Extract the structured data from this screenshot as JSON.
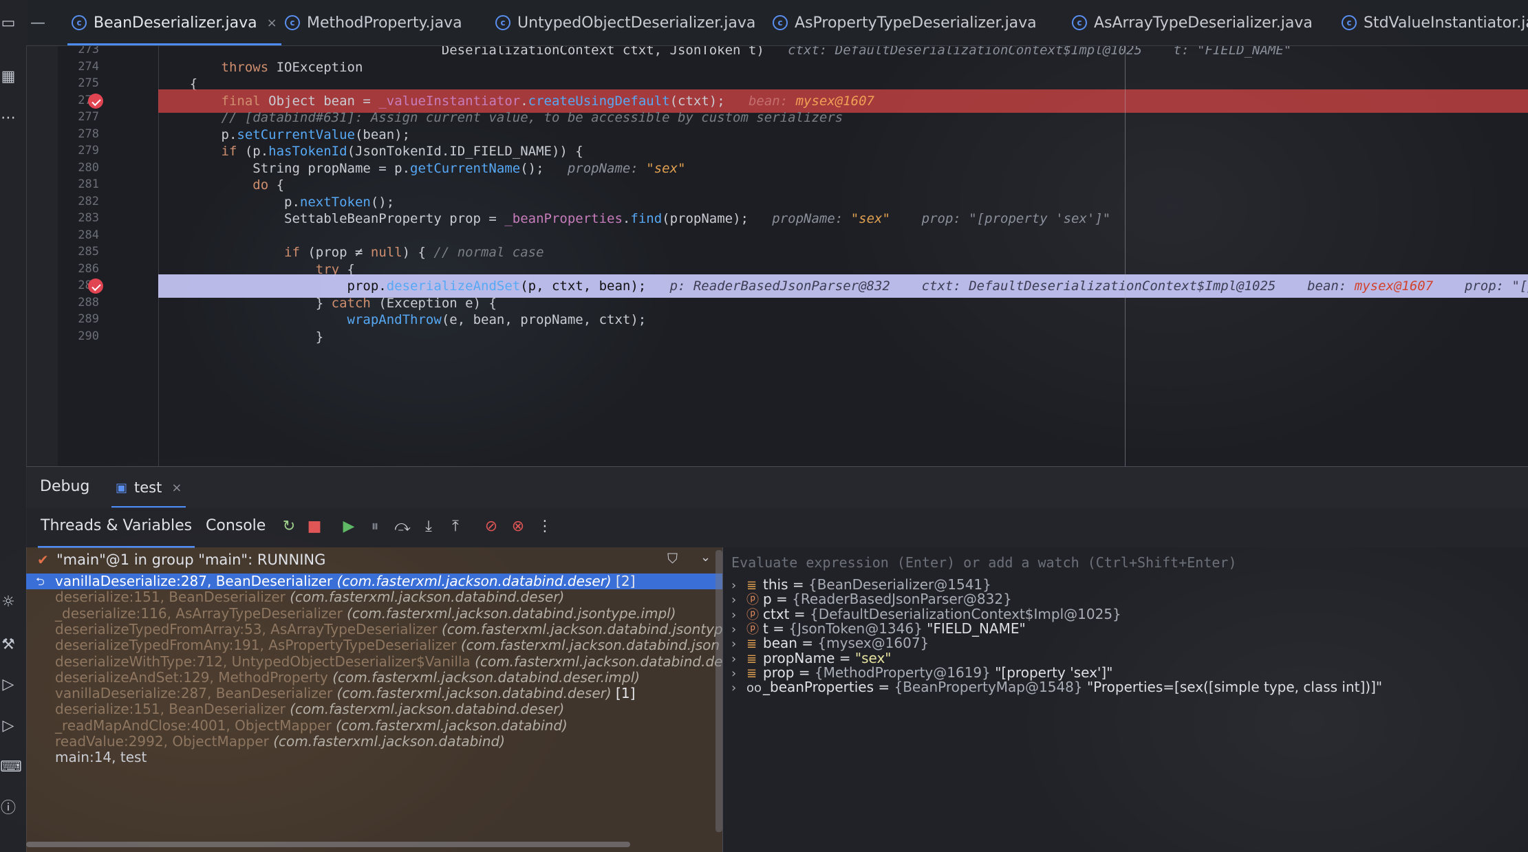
{
  "tabs": [
    {
      "label": "BeanDeserializer.java",
      "active": true,
      "closable": true
    },
    {
      "label": "MethodProperty.java"
    },
    {
      "label": "UntypedObjectDeserializer.java"
    },
    {
      "label": "AsPropertyTypeDeserializer.java"
    },
    {
      "label": "AsArrayTypeDeserializer.java"
    },
    {
      "label": "StdValueInstantiator.jav"
    }
  ],
  "editor": {
    "lines": [
      {
        "num": "273",
        "code": "                                    DeserializationContext ctxt, JsonToken t)",
        "hint": "ctxt: DefaultDeserializationContext$Impl@1025    t: \"FIELD_NAME\""
      },
      {
        "num": "274",
        "code": "        throws IOException"
      },
      {
        "num": "275",
        "code": "    {"
      },
      {
        "num": "276",
        "code": "        final Object bean = _valueInstantiator.createUsingDefault(ctxt);",
        "hint": "bean:",
        "hint_value": "mysex@1607",
        "state": "breakpoint"
      },
      {
        "num": "277",
        "code": "        // [databind#631]: Assign current value, to be accessible by custom serializers"
      },
      {
        "num": "278",
        "code": "        p.setCurrentValue(bean);"
      },
      {
        "num": "279",
        "code": "        if (p.hasTokenId(JsonTokenId.ID_FIELD_NAME)) {"
      },
      {
        "num": "280",
        "code": "            String propName = p.getCurrentName();",
        "hint": "propName:",
        "hint_value": "\"sex\""
      },
      {
        "num": "281",
        "code": "            do {"
      },
      {
        "num": "282",
        "code": "                p.nextToken();"
      },
      {
        "num": "283",
        "code": "                SettableBeanProperty prop = _beanProperties.find(propName);",
        "hint": "propName:",
        "hint_value": "\"sex\"",
        "hint2": "prop: \"[property 'sex']\""
      },
      {
        "num": "284",
        "code": ""
      },
      {
        "num": "285",
        "code": "                if (prop ≠ null) { // normal case"
      },
      {
        "num": "286",
        "code": "                    try {"
      },
      {
        "num": "287",
        "code": "                        prop.deserializeAndSet(p, ctxt, bean);",
        "hint": "p: ReaderBasedJsonParser@832    ctxt: DefaultDeserializationContext$Impl@1025    bean:",
        "hint_value": "mysex@1607",
        "hint2": "prop: \"[propert",
        "state": "execution"
      },
      {
        "num": "288",
        "code": "                    } catch (Exception e) {"
      },
      {
        "num": "289",
        "code": "                        wrapAndThrow(e, bean, propName, ctxt);"
      },
      {
        "num": "290",
        "code": "                    }"
      }
    ]
  },
  "debug": {
    "title": "Debug",
    "session_tab": "test",
    "subtabs": [
      "Threads & Variables",
      "Console"
    ],
    "thread_status": "\"main\"@1 in group \"main\": RUNNING",
    "frames": [
      {
        "method": "vanillaDeserialize:287, BeanDeserializer",
        "pkg": "(com.fasterxml.jackson.databind.deser)",
        "suffix": "[2]",
        "selected": true
      },
      {
        "method": "deserialize:151, BeanDeserializer",
        "pkg": "(com.fasterxml.jackson.databind.deser)"
      },
      {
        "method": "_deserialize:116, AsArrayTypeDeserializer",
        "pkg": "(com.fasterxml.jackson.databind.jsontype.impl)"
      },
      {
        "method": "deserializeTypedFromArray:53, AsArrayTypeDeserializer",
        "pkg": "(com.fasterxml.jackson.databind.jsontyp"
      },
      {
        "method": "deserializeTypedFromAny:191, AsPropertyTypeDeserializer",
        "pkg": "(com.fasterxml.jackson.databind.json"
      },
      {
        "method": "deserializeWithType:712, UntypedObjectDeserializer$Vanilla",
        "pkg": "(com.fasterxml.jackson.databind.des"
      },
      {
        "method": "deserializeAndSet:129, MethodProperty",
        "pkg": "(com.fasterxml.jackson.databind.deser.impl)"
      },
      {
        "method": "vanillaDeserialize:287, BeanDeserializer",
        "pkg": "(com.fasterxml.jackson.databind.deser)",
        "suffix": "[1]"
      },
      {
        "method": "deserialize:151, BeanDeserializer",
        "pkg": "(com.fasterxml.jackson.databind.deser)"
      },
      {
        "method": "_readMapAndClose:4001, ObjectMapper",
        "pkg": "(com.fasterxml.jackson.databind)"
      },
      {
        "method": "readValue:2992, ObjectMapper",
        "pkg": "(com.fasterxml.jackson.databind)"
      },
      {
        "method": "main:14, test",
        "pkg": "",
        "plain": true
      }
    ],
    "eval_placeholder": "Evaluate expression (Enter) or add a watch (Ctrl+Shift+Enter)",
    "variables": [
      {
        "icon": "field-icon",
        "glyph": "≣",
        "name": "this",
        "value": "{BeanDeserializer@1541}",
        "extra": ""
      },
      {
        "icon": "param-icon",
        "glyph": "ⓟ",
        "name": "p",
        "value": "{ReaderBasedJsonParser@832}",
        "extra": ""
      },
      {
        "icon": "param-icon",
        "glyph": "ⓟ",
        "name": "ctxt",
        "value": "{DefaultDeserializationContext$Impl@1025}",
        "extra": ""
      },
      {
        "icon": "param-icon",
        "glyph": "ⓟ",
        "name": "t",
        "value": "{JsonToken@1346}",
        "extra": "\"FIELD_NAME\""
      },
      {
        "icon": "field-icon",
        "glyph": "≣",
        "name": "bean",
        "value": "{mysex@1607}",
        "extra": ""
      },
      {
        "icon": "field-icon",
        "glyph": "≣",
        "name": "propName",
        "value": "",
        "extra": "\"sex\"",
        "string": true
      },
      {
        "icon": "field-icon",
        "glyph": "≣",
        "name": "prop",
        "value": "{MethodProperty@1619}",
        "extra": "\"[property 'sex']\""
      },
      {
        "icon": "watch-icon",
        "glyph": "oo",
        "name": "_beanProperties",
        "value": "{BeanPropertyMap@1548}",
        "extra": "\"Properties=[sex([simple type, class int])]\""
      }
    ]
  }
}
